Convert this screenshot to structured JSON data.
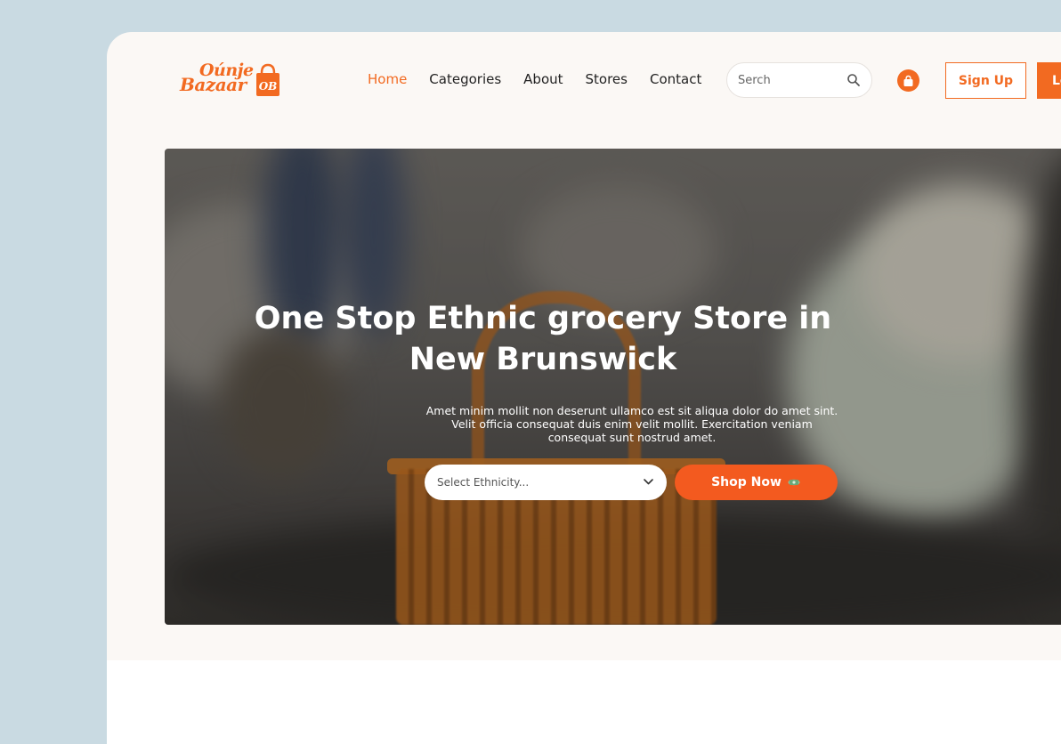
{
  "brand": {
    "logo_line1": "Oúnje",
    "logo_line2": "Bazaar",
    "logo_mark": "OB"
  },
  "nav": {
    "items": [
      {
        "label": "Home",
        "active": true
      },
      {
        "label": "Categories"
      },
      {
        "label": "About"
      },
      {
        "label": "Stores"
      },
      {
        "label": "Contact"
      }
    ]
  },
  "search": {
    "placeholder": "Serch",
    "icon": "search-icon"
  },
  "header": {
    "cart_icon": "shopping-bag-icon",
    "signup_label": "Sign Up",
    "login_label": "Log In"
  },
  "hero": {
    "title_line1": "One Stop Ethnic grocery Store in",
    "title_line2": "New Brunswick",
    "description": "Amet minim mollit non deserunt ullamco est sit aliqua dolor do amet sint. Velit officia consequat duis enim velit mollit. Exercitation veniam consequat sunt nostrud amet.",
    "select_value": "Select Ethnicity...",
    "shop_label": "Shop Now"
  },
  "colors": {
    "accent": "#f26a21",
    "page_bg": "#c9dae2",
    "frame_bg": "#fbf8f5"
  }
}
